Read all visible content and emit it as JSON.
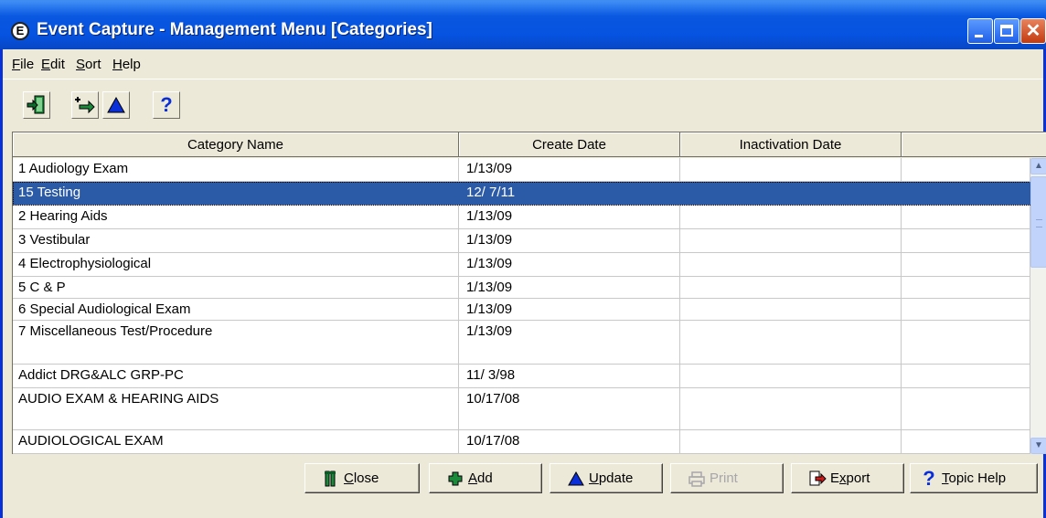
{
  "window": {
    "title": "Event Capture - Management Menu [Categories]",
    "app_icon_letter": "E",
    "title_color": "#0a58e0"
  },
  "menu": {
    "file": {
      "first": "F",
      "rest": "ile"
    },
    "edit": {
      "first": "E",
      "rest": "dit"
    },
    "sort": {
      "first": "S",
      "rest": "ort"
    },
    "help": {
      "first": "H",
      "rest": "elp"
    }
  },
  "toolbar": {
    "exit_icon": "exit-door-icon",
    "add_icon": "add-arrow-icon",
    "update_icon": "up-triangle-icon",
    "help_icon": "question-mark-icon"
  },
  "table": {
    "headers": [
      "Category Name",
      "Create Date",
      "Inactivation Date",
      ""
    ],
    "rows": [
      {
        "name": "1 Audiology Exam",
        "created": "1/13/09",
        "inactivated": "",
        "selected": false
      },
      {
        "name": "15 Testing",
        "created": "12/ 7/11",
        "inactivated": "",
        "selected": true
      },
      {
        "name": "2 Hearing Aids",
        "created": "1/13/09",
        "inactivated": "",
        "selected": false
      },
      {
        "name": "3 Vestibular",
        "created": "1/13/09",
        "inactivated": "",
        "selected": false
      },
      {
        "name": "4 Electrophysiological",
        "created": "1/13/09",
        "inactivated": "",
        "selected": false
      },
      {
        "name": "5 C & P",
        "created": "1/13/09",
        "inactivated": "",
        "selected": false
      },
      {
        "name": "6 Special Audiological Exam",
        "created": "1/13/09",
        "inactivated": "",
        "selected": false
      },
      {
        "name": "7 Miscellaneous Test/Procedure",
        "created": "1/13/09",
        "inactivated": "",
        "selected": false
      },
      {
        "name": "Addict DRG&ALC GRP-PC",
        "created": "11/ 3/98",
        "inactivated": "",
        "selected": false
      },
      {
        "name": "AUDIO EXAM & HEARING AIDS",
        "created": "10/17/08",
        "inactivated": "",
        "selected": false
      },
      {
        "name": "AUDIOLOGICAL EXAM",
        "created": "10/17/08",
        "inactivated": "",
        "selected": false
      }
    ],
    "selected_color": "#2b5aa6"
  },
  "buttons": {
    "close": {
      "first": "C",
      "rest": "lose",
      "enabled": true
    },
    "add": {
      "first": "A",
      "rest": "dd",
      "enabled": true
    },
    "update": {
      "first": "U",
      "rest": "pdate",
      "enabled": true
    },
    "print": {
      "label": "Print",
      "enabled": false
    },
    "export": {
      "pre": "E",
      "u": "x",
      "rest": "port",
      "enabled": true
    },
    "topic_help": {
      "first": "T",
      "rest": "opic Help",
      "enabled": true
    }
  }
}
